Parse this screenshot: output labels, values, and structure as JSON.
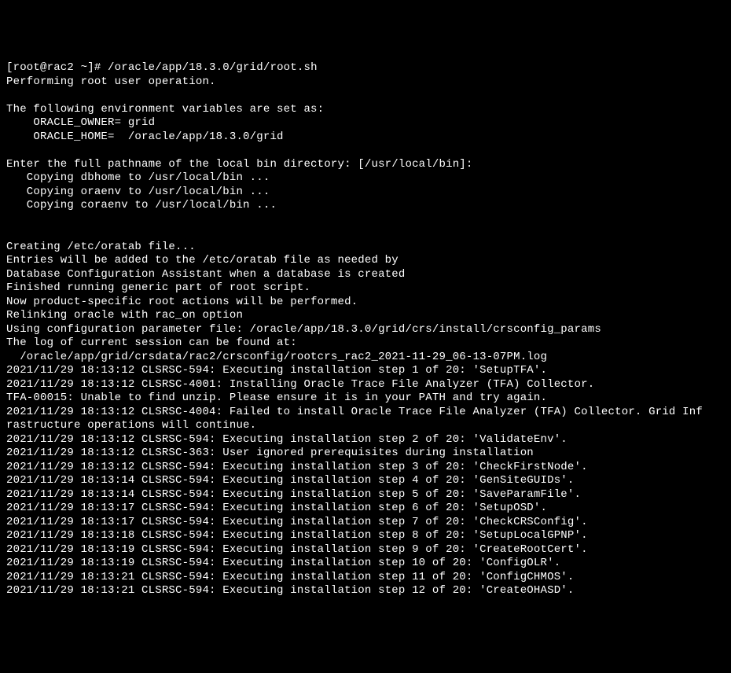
{
  "terminal": {
    "prompt": "[root@rac2 ~]# ",
    "command": "/oracle/app/18.3.0/grid/root.sh",
    "lines": [
      "Performing root user operation.",
      "",
      "The following environment variables are set as:",
      "    ORACLE_OWNER= grid",
      "    ORACLE_HOME=  /oracle/app/18.3.0/grid",
      "",
      "Enter the full pathname of the local bin directory: [/usr/local/bin]:",
      "   Copying dbhome to /usr/local/bin ...",
      "   Copying oraenv to /usr/local/bin ...",
      "   Copying coraenv to /usr/local/bin ...",
      "",
      "",
      "Creating /etc/oratab file...",
      "Entries will be added to the /etc/oratab file as needed by",
      "Database Configuration Assistant when a database is created",
      "Finished running generic part of root script.",
      "Now product-specific root actions will be performed.",
      "Relinking oracle with rac_on option",
      "Using configuration parameter file: /oracle/app/18.3.0/grid/crs/install/crsconfig_params",
      "The log of current session can be found at:",
      "  /oracle/app/grid/crsdata/rac2/crsconfig/rootcrs_rac2_2021-11-29_06-13-07PM.log",
      "2021/11/29 18:13:12 CLSRSC-594: Executing installation step 1 of 20: 'SetupTFA'.",
      "2021/11/29 18:13:12 CLSRSC-4001: Installing Oracle Trace File Analyzer (TFA) Collector.",
      "TFA-00015: Unable to find unzip. Please ensure it is in your PATH and try again.",
      "2021/11/29 18:13:12 CLSRSC-4004: Failed to install Oracle Trace File Analyzer (TFA) Collector. Grid Inf",
      "rastructure operations will continue.",
      "2021/11/29 18:13:12 CLSRSC-594: Executing installation step 2 of 20: 'ValidateEnv'.",
      "2021/11/29 18:13:12 CLSRSC-363: User ignored prerequisites during installation",
      "2021/11/29 18:13:12 CLSRSC-594: Executing installation step 3 of 20: 'CheckFirstNode'.",
      "2021/11/29 18:13:14 CLSRSC-594: Executing installation step 4 of 20: 'GenSiteGUIDs'.",
      "2021/11/29 18:13:14 CLSRSC-594: Executing installation step 5 of 20: 'SaveParamFile'.",
      "2021/11/29 18:13:17 CLSRSC-594: Executing installation step 6 of 20: 'SetupOSD'.",
      "2021/11/29 18:13:17 CLSRSC-594: Executing installation step 7 of 20: 'CheckCRSConfig'.",
      "2021/11/29 18:13:18 CLSRSC-594: Executing installation step 8 of 20: 'SetupLocalGPNP'.",
      "2021/11/29 18:13:19 CLSRSC-594: Executing installation step 9 of 20: 'CreateRootCert'.",
      "2021/11/29 18:13:19 CLSRSC-594: Executing installation step 10 of 20: 'ConfigOLR'.",
      "2021/11/29 18:13:21 CLSRSC-594: Executing installation step 11 of 20: 'ConfigCHMOS'.",
      "2021/11/29 18:13:21 CLSRSC-594: Executing installation step 12 of 20: 'CreateOHASD'."
    ]
  }
}
